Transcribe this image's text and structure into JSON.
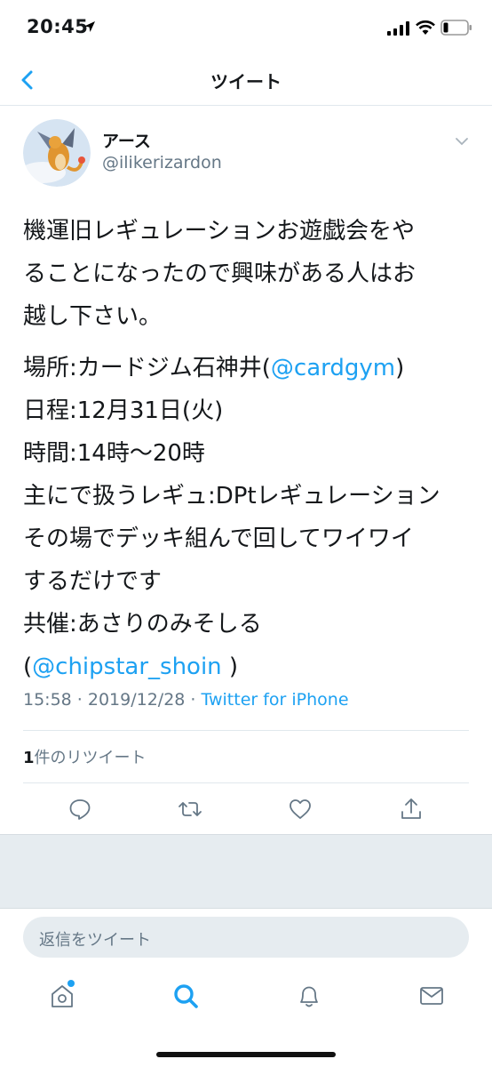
{
  "status_bar": {
    "time": "20:45"
  },
  "nav": {
    "title": "ツイート"
  },
  "author": {
    "display_name": "アース",
    "handle": "@ilikerizardon"
  },
  "tweet": {
    "lines": [
      "機運旧レギュレーションお遊戯会をや",
      "ることになったので興味がある人はお",
      "越し下さい。"
    ],
    "place_prefix": "場所:カードジム石神井(",
    "place_mention": "@cardgym",
    "place_suffix": ")",
    "date_line": "日程:12月31日(火)",
    "time_line": "時間:14時〜20時",
    "rule_line": "主にで扱うレギュ:DPtレギュレーション",
    "play_line_1": "その場でデッキ組んで回してワイワイ",
    "play_line_2": "するだけです",
    "host_line": "共催:あさりのみそしる",
    "host_open": "(",
    "host_mention": "@chipstar_shoin",
    "host_close": " )"
  },
  "meta": {
    "timestamp": "15:58 · 2019/12/28 · ",
    "source": "Twitter for iPhone"
  },
  "retweets": {
    "count": "1",
    "label": "件のリツイート"
  },
  "reply": {
    "placeholder": "返信をツイート"
  },
  "colors": {
    "accent": "#1da1f2",
    "muted": "#657786",
    "divider": "#e1e8ed",
    "panel": "#e6ecf0"
  },
  "icons": {
    "actions": [
      "reply-icon",
      "retweet-icon",
      "like-icon",
      "share-icon"
    ],
    "tabs": [
      "home-icon",
      "search-icon",
      "notifications-icon",
      "messages-icon"
    ]
  }
}
